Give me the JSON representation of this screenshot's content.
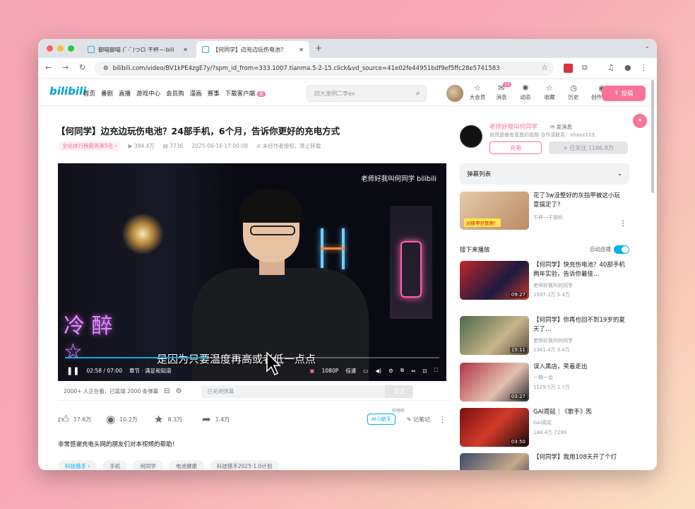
{
  "browser": {
    "tabs": [
      {
        "label": "御喵御喵 (ﾟ-ﾟ)つロ 干杯~-bili",
        "active": false
      },
      {
        "label": "【何同学】边充边玩伤电池?",
        "active": true
      }
    ],
    "new_tab": "+",
    "url": "bilibili.com/video/BV1kPE4zgE7y/?spm_id_from=333.1007.tianma.5-2-15.click&vd_source=41e02fe44951bdf9ef5ffc28e5741583"
  },
  "site_header": {
    "logo": "bilibili",
    "nav": [
      "首页",
      "番剧",
      "直播",
      "游戏中心",
      "会员购",
      "漫画",
      "赛事",
      "下载客户端"
    ],
    "download_badge": "新",
    "search_placeholder": "四大发明二李ex",
    "right_items": [
      {
        "icon": "vip-icon",
        "label": "大会员",
        "glyph": "☆"
      },
      {
        "icon": "message-icon",
        "label": "消息",
        "glyph": "✉"
      },
      {
        "icon": "dynamic-icon",
        "label": "动态",
        "glyph": "✺"
      },
      {
        "icon": "favorite-icon",
        "label": "收藏",
        "glyph": "☆"
      },
      {
        "icon": "history-icon",
        "label": "历史",
        "glyph": "◷"
      },
      {
        "icon": "creator-icon",
        "label": "创作中心",
        "glyph": "◉"
      }
    ],
    "message_count": "19",
    "upload": "投稿"
  },
  "video": {
    "title": "【何同学】边充边玩伤电池？24部手机，6个月，告诉你更好的充电方式",
    "rank": "全站排行榜最高第5名 ›",
    "plays": "394.4万",
    "danmaku": "7736",
    "date": "2025-06-16 17:00:00",
    "copyright": "未经作者授权，禁止转载",
    "watermark": "老师好我叫何同学 bilibili",
    "subtitle": "是因为只要温度再高或者低一点点",
    "progress": 0.38,
    "time": "02:58 / 07:00",
    "chapter": "章节 · 满足和知道",
    "quality": "1080P",
    "speed": "倍速",
    "neon_left": "冷 醉 ☆",
    "neon_right": "H"
  },
  "danmu_bar": {
    "viewers": "2000+ 人正在看，已装填 2000 条弹幕",
    "input_placeholder": "已关闭弹幕",
    "send": "发送"
  },
  "actions": {
    "like": "17.6万",
    "coin": "10.2万",
    "fav": "8.3万",
    "share": "1.4万",
    "ai": "AI小助手",
    "ai_tag": "哔哩哔",
    "note": "记笔记"
  },
  "description": "非常感谢充电头网的朋友们对本视频的帮助！",
  "tags": [
    "科技猎手 ›",
    "手机",
    "何同学",
    "电池健康",
    "科技猎手2025·1.0计划"
  ],
  "uploader": {
    "name": "老师好我叫何同学",
    "message": "✉ 发消息",
    "desc": "自然是做有意思的视频 合作请联系：xhaxx123.",
    "charge": "充电",
    "follow": "+ 已关注 1186.8万"
  },
  "danmaku_list": "弹幕列表",
  "ad": {
    "title": "花了3w没整好的灰指甲被这小玩意搞定了?",
    "label": "对抹甲巨管用！",
    "source": "千秤一干探析"
  },
  "next_header": "接下来播放",
  "autoplay": "自动连播",
  "recommendations": [
    {
      "title": "【何同学】快充伤电池？40部手机两年实验，告诉你最佳…",
      "author": "老师好我叫何同学",
      "plays": "1597.3万",
      "comments": "5.4万",
      "duration": "09:27"
    },
    {
      "title": "【何同学】你再也回不到19岁的夏天了…",
      "author": "老师好我叫何同学",
      "plays": "1341.4万",
      "comments": "3.4万",
      "duration": "15:11"
    },
    {
      "title": "误入黑店，笑着走出",
      "author": "一期一会",
      "plays": "1129.5万",
      "comments": "1.7万",
      "duration": "03:27"
    },
    {
      "title": "GAI周延｜《歌手》炁",
      "author": "GAI周延",
      "plays": "184.4万",
      "comments": "7299",
      "duration": "03:50"
    },
    {
      "title": "【何同学】我用108天开了个灯",
      "author": "",
      "plays": "",
      "comments": "",
      "duration": ""
    }
  ],
  "colors": {
    "accent": "#00aeec",
    "pink": "#fb7299"
  }
}
